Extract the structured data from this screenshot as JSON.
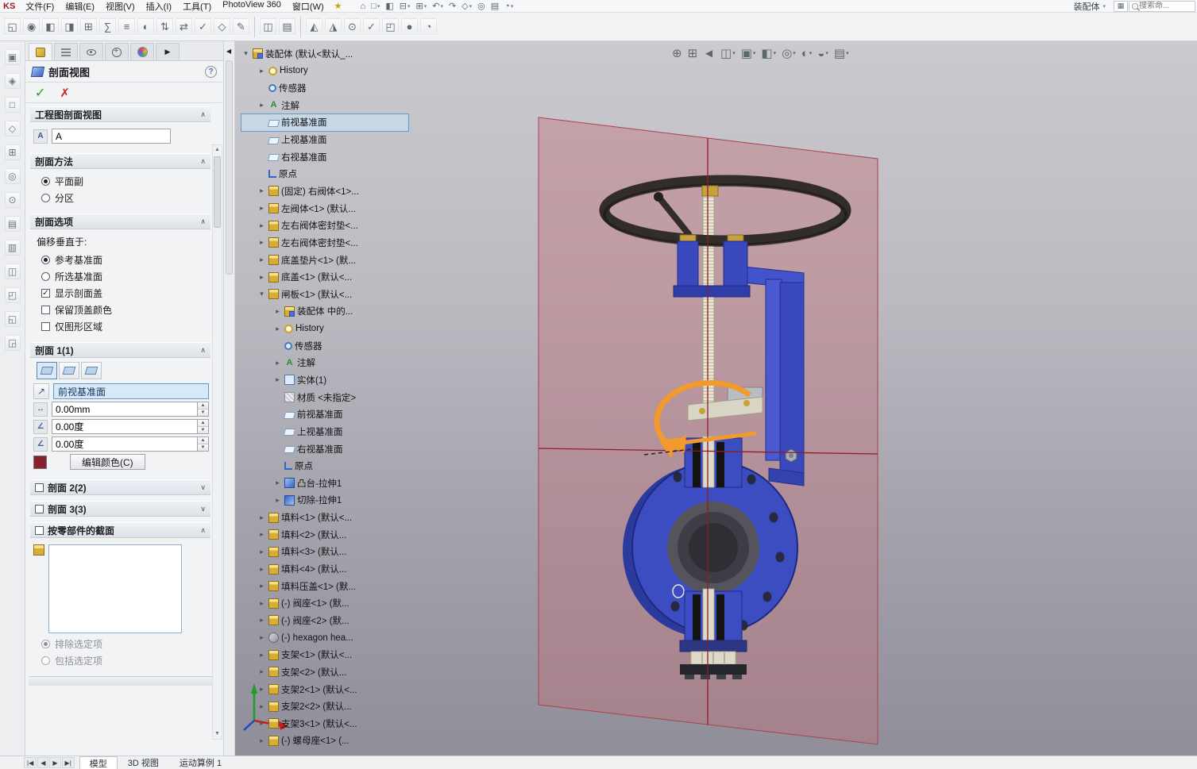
{
  "menubar": {
    "brand": "KS",
    "items": [
      "文件(F)",
      "编辑(E)",
      "视图(V)",
      "插入(I)",
      "工具(T)",
      "PhotoView 360",
      "窗口(W)"
    ],
    "star": "★",
    "quick_icons": [
      {
        "name": "home-icon",
        "glyph": "⌂",
        "caret": false
      },
      {
        "name": "new-document-icon",
        "glyph": "□",
        "caret": true
      },
      {
        "name": "open-document-icon",
        "glyph": "◧",
        "caret": false
      },
      {
        "name": "save-icon",
        "glyph": "⊟",
        "caret": true
      },
      {
        "name": "print-icon",
        "glyph": "⊞",
        "caret": true
      },
      {
        "name": "undo-icon",
        "glyph": "↶",
        "caret": true
      },
      {
        "name": "redo-icon",
        "glyph": "↷",
        "caret": false
      },
      {
        "name": "select-icon",
        "glyph": "◇",
        "caret": true
      },
      {
        "name": "rebuild-icon",
        "glyph": "◎",
        "caret": false
      },
      {
        "name": "file-properties-icon",
        "glyph": "▤",
        "caret": false
      },
      {
        "name": "options-icon",
        "glyph": "◔",
        "caret": true
      }
    ],
    "mode_label": "装配体",
    "search_placeholder": "搜索命..."
  },
  "toolbar": {
    "groups": [
      {
        "icons": [
          {
            "name": "tool-icon-1",
            "glyph": "◱"
          },
          {
            "name": "tool-icon-2",
            "glyph": "◉"
          },
          {
            "name": "tool-icon-3",
            "glyph": "◧"
          },
          {
            "name": "tool-icon-4",
            "glyph": "◨"
          },
          {
            "name": "tool-icon-5",
            "glyph": "⊞"
          },
          {
            "name": "tool-icon-6",
            "glyph": "∑"
          },
          {
            "name": "tool-icon-7",
            "glyph": "≡"
          },
          {
            "name": "tool-icon-8",
            "glyph": "◐"
          },
          {
            "name": "tool-icon-9",
            "glyph": "⇅"
          },
          {
            "name": "tool-icon-10",
            "glyph": "⇄"
          },
          {
            "name": "tool-icon-11",
            "glyph": "✓"
          },
          {
            "name": "tool-icon-12",
            "glyph": "◇"
          },
          {
            "name": "tool-icon-13",
            "glyph": "✎"
          }
        ]
      },
      {
        "icons": [
          {
            "name": "tool-icon-14",
            "glyph": "◫"
          },
          {
            "name": "tool-icon-15",
            "glyph": "▤"
          }
        ]
      },
      {
        "icons": [
          {
            "name": "tool-icon-16",
            "glyph": "◭"
          },
          {
            "name": "tool-icon-17",
            "glyph": "◮"
          },
          {
            "name": "tool-icon-18",
            "glyph": "⊙"
          },
          {
            "name": "tool-icon-19",
            "glyph": "✓"
          },
          {
            "name": "tool-icon-20",
            "glyph": "◰"
          },
          {
            "name": "tool-icon-21",
            "glyph": "●"
          },
          {
            "name": "tool-icon-22",
            "glyph": "◔"
          }
        ]
      }
    ]
  },
  "left_toolbar": {
    "icons": [
      {
        "name": "side-tool-icon-1",
        "glyph": "▣"
      },
      {
        "name": "side-tool-icon-2",
        "glyph": "◈"
      },
      {
        "name": "side-tool-icon-3",
        "glyph": "□"
      },
      {
        "name": "side-tool-icon-4",
        "glyph": "◇"
      },
      {
        "name": "side-tool-icon-5",
        "glyph": "⊞"
      },
      {
        "name": "side-tool-icon-6",
        "glyph": "◎"
      },
      {
        "name": "side-tool-icon-7",
        "glyph": "⊙"
      },
      {
        "name": "side-tool-icon-8",
        "glyph": "▤"
      },
      {
        "name": "side-tool-icon-9",
        "glyph": "▥"
      },
      {
        "name": "side-tool-icon-10",
        "glyph": "◫"
      },
      {
        "name": "side-tool-icon-11",
        "glyph": "◰"
      },
      {
        "name": "side-tool-icon-12",
        "glyph": "◱"
      },
      {
        "name": "side-tool-icon-13",
        "glyph": "◲"
      }
    ]
  },
  "property_panel": {
    "title": "剖面视图",
    "help": "?",
    "ok": "✓",
    "cancel": "✗",
    "caret_open": "∧",
    "caret_collapsed": "∨",
    "groups": {
      "drawing": {
        "title": "工程图剖面视图",
        "value": "A"
      },
      "method": {
        "title": "剖面方法",
        "radios": [
          {
            "label": "平面副",
            "selected": true
          },
          {
            "label": "分区",
            "selected": false
          }
        ]
      },
      "options": {
        "title": "剖面选项",
        "offset_label": "偏移垂直于:",
        "radios": [
          {
            "label": "参考基准面",
            "selected": true
          },
          {
            "label": "所选基准面",
            "selected": false
          }
        ],
        "checks": [
          {
            "label": "显示剖面盖",
            "checked": true
          },
          {
            "label": "保留顶盖颜色",
            "checked": false
          },
          {
            "label": "仅图形区域",
            "checked": false
          }
        ]
      },
      "s1": {
        "title": "剖面 1(1)",
        "plane": "前视基准面",
        "offset": "0.00mm",
        "rot1": "0.00度",
        "rot2": "0.00度",
        "swatch": "#8a1f2e",
        "edit_color": "编辑颜色(C)"
      },
      "s2": {
        "title": "剖面 2(2)"
      },
      "s3": {
        "title": "剖面 3(3)"
      },
      "bycomp": {
        "title": "按零部件的截面",
        "radios": [
          {
            "label": "排除选定项",
            "selected": true
          },
          {
            "label": "包括选定项",
            "selected": false
          }
        ]
      }
    }
  },
  "feature_tree": {
    "items": [
      {
        "label": "装配体 (默认<默认_...",
        "level": 0,
        "arrow": "down",
        "icon": "assembly"
      },
      {
        "label": "History",
        "level": 1,
        "arrow": "right",
        "icon": "history"
      },
      {
        "label": "传感器",
        "level": 1,
        "arrow": "",
        "icon": "sensor"
      },
      {
        "label": "注解",
        "level": 1,
        "arrow": "right",
        "icon": "annotation"
      },
      {
        "label": "前视基准面",
        "level": 1,
        "arrow": "",
        "icon": "plane",
        "sel": true
      },
      {
        "label": "上视基准面",
        "level": 1,
        "arrow": "",
        "icon": "plane"
      },
      {
        "label": "右视基准面",
        "level": 1,
        "arrow": "",
        "icon": "plane"
      },
      {
        "label": "原点",
        "level": 1,
        "arrow": "",
        "icon": "origin"
      },
      {
        "label": "(固定) 右阀体<1>...",
        "level": 1,
        "arrow": "right",
        "icon": "part"
      },
      {
        "label": "左阀体<1> (默认...",
        "level": 1,
        "arrow": "right",
        "icon": "part"
      },
      {
        "label": "左右阀体密封垫<...",
        "level": 1,
        "arrow": "right",
        "icon": "part"
      },
      {
        "label": "左右阀体密封垫<...",
        "level": 1,
        "arrow": "right",
        "icon": "part"
      },
      {
        "label": "底盖垫片<1> (默...",
        "level": 1,
        "arrow": "right",
        "icon": "part"
      },
      {
        "label": "底盖<1> (默认<...",
        "level": 1,
        "arrow": "right",
        "icon": "part"
      },
      {
        "label": "闸板<1> (默认<...",
        "level": 1,
        "arrow": "down",
        "icon": "part"
      },
      {
        "label": "装配体 中的...",
        "level": 2,
        "arrow": "right",
        "icon": "assembly"
      },
      {
        "label": "History",
        "level": 2,
        "arrow": "right",
        "icon": "history"
      },
      {
        "label": "传感器",
        "level": 2,
        "arrow": "",
        "icon": "sensor"
      },
      {
        "label": "注解",
        "level": 2,
        "arrow": "right",
        "icon": "annotation"
      },
      {
        "label": "实体(1)",
        "level": 2,
        "arrow": "right",
        "icon": "bodyfolder"
      },
      {
        "label": "材质 <未指定>",
        "level": 2,
        "arrow": "",
        "icon": "material"
      },
      {
        "label": "前视基准面",
        "level": 2,
        "arrow": "",
        "icon": "plane"
      },
      {
        "label": "上视基准面",
        "level": 2,
        "arrow": "",
        "icon": "plane"
      },
      {
        "label": "右视基准面",
        "level": 2,
        "arrow": "",
        "icon": "plane"
      },
      {
        "label": "原点",
        "level": 2,
        "arrow": "",
        "icon": "origin"
      },
      {
        "label": "凸台-拉伸1",
        "level": 2,
        "arrow": "right",
        "icon": "boss"
      },
      {
        "label": "切除-拉伸1",
        "level": 2,
        "arrow": "right",
        "icon": "cut"
      },
      {
        "label": "填料<1> (默认<...",
        "level": 1,
        "arrow": "right",
        "icon": "part"
      },
      {
        "label": "填料<2> (默认...",
        "level": 1,
        "arrow": "right",
        "icon": "part"
      },
      {
        "label": "填料<3> (默认...",
        "level": 1,
        "arrow": "right",
        "icon": "part"
      },
      {
        "label": "填料<4> (默认...",
        "level": 1,
        "arrow": "right",
        "icon": "part"
      },
      {
        "label": "填料压盖<1> (默...",
        "level": 1,
        "arrow": "right",
        "icon": "part"
      },
      {
        "label": "(-) 阀座<1> (默...",
        "level": 1,
        "arrow": "right",
        "icon": "part"
      },
      {
        "label": "(-) 阀座<2> (默...",
        "level": 1,
        "arrow": "right",
        "icon": "part"
      },
      {
        "label": "(-) hexagon hea...",
        "level": 1,
        "arrow": "right",
        "icon": "bolt"
      },
      {
        "label": "支架<1> (默认<...",
        "level": 1,
        "arrow": "right",
        "icon": "part"
      },
      {
        "label": "支架<2> (默认...",
        "level": 1,
        "arrow": "right",
        "icon": "part"
      },
      {
        "label": "支架2<1> (默认<...",
        "level": 1,
        "arrow": "right",
        "icon": "part"
      },
      {
        "label": "支架2<2> (默认...",
        "level": 1,
        "arrow": "right",
        "icon": "part"
      },
      {
        "label": "支架3<1> (默认<...",
        "level": 1,
        "arrow": "right",
        "icon": "part"
      },
      {
        "label": "(-) 螺母座<1> (...",
        "level": 1,
        "arrow": "right",
        "icon": "part"
      }
    ]
  },
  "viewport": {
    "hud_icons": [
      {
        "name": "zoom-fit-icon",
        "glyph": "⊕",
        "caret": false
      },
      {
        "name": "zoom-area-icon",
        "glyph": "⊞",
        "caret": false
      },
      {
        "name": "previous-view-icon",
        "glyph": "◄",
        "caret": false
      },
      {
        "name": "section-view-icon",
        "glyph": "◫",
        "caret": true
      },
      {
        "name": "view-orientation-icon",
        "glyph": "▣",
        "caret": true
      },
      {
        "name": "display-style-icon",
        "glyph": "◧",
        "caret": true
      },
      {
        "name": "hide-show-items-icon",
        "glyph": "◎",
        "caret": true
      },
      {
        "name": "edit-appearance-icon",
        "glyph": "◐",
        "caret": true
      },
      {
        "name": "apply-scene-icon",
        "glyph": "◒",
        "caret": true
      },
      {
        "name": "view-settings-icon",
        "glyph": "▤",
        "caret": true
      }
    ],
    "colors": {
      "plane": "#c1707a",
      "plane_edge": "#a8434e",
      "cross": "#8c1f24",
      "body": "#3c4dc2",
      "body_dark": "#2c3a9e",
      "seal": "#131313",
      "gate": "#ded9c9",
      "stem": "#ece7d6",
      "wheel": "#332d2a",
      "arrow": "#f29a2e"
    }
  },
  "status_bar": {
    "nav": [
      "|◀",
      "◀",
      "▶",
      "▶|"
    ],
    "tabs": [
      {
        "label": "模型",
        "active": true
      },
      {
        "label": "3D 视图",
        "active": false
      },
      {
        "label": "运动算例 1",
        "active": false
      }
    ]
  }
}
